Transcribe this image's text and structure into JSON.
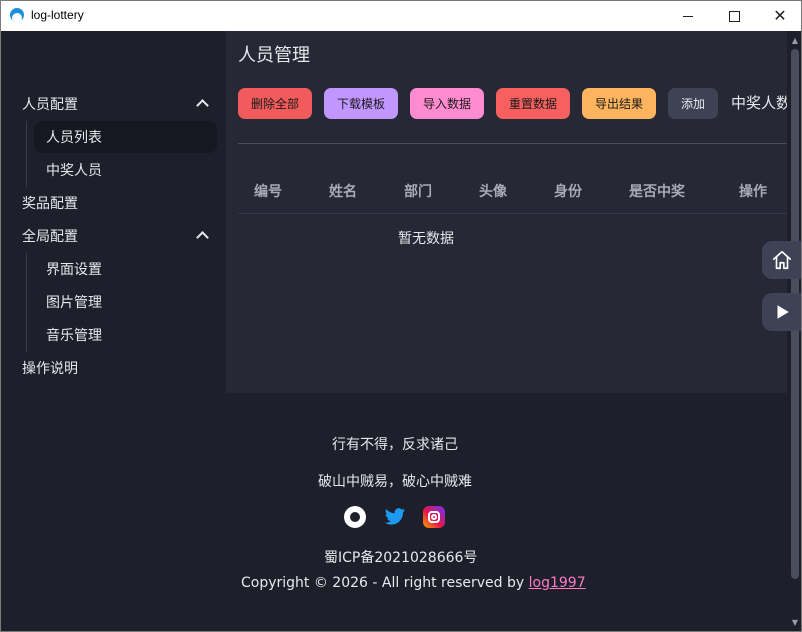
{
  "window": {
    "title": "log-lottery",
    "controls": {
      "minimize": "—",
      "maximize": "□",
      "close": "✕"
    }
  },
  "sidebar": {
    "items": [
      {
        "label": "人员配置",
        "expanded": true,
        "children": [
          {
            "label": "人员列表",
            "active": true
          },
          {
            "label": "中奖人员",
            "active": false
          }
        ]
      },
      {
        "label": "奖品配置"
      },
      {
        "label": "全局配置",
        "expanded": true,
        "children": [
          {
            "label": "界面设置"
          },
          {
            "label": "图片管理"
          },
          {
            "label": "音乐管理"
          }
        ]
      },
      {
        "label": "操作说明"
      }
    ]
  },
  "main": {
    "title": "人员管理",
    "buttons": {
      "delete_all": "删除全部",
      "download_template": "下载模板",
      "import": "导入数据",
      "reset": "重置数据",
      "export": "导出结果",
      "add": "添加"
    },
    "winner_label": "中奖人数",
    "table": {
      "headers": [
        "编号",
        "姓名",
        "部门",
        "头像",
        "身份",
        "是否中奖",
        "操作"
      ],
      "empty_text": "暂无数据"
    }
  },
  "footer": {
    "quote_1": "行有不得，反求诸己",
    "quote_2": "破山中贼易，破心中贼难",
    "icp": "蜀ICP备2021028666号",
    "copyright": "Copyright © 2026 - All right reserved by",
    "author_link": "log1997",
    "social_icons": [
      "github-icon",
      "twitter-icon",
      "instagram-icon"
    ]
  },
  "colors": {
    "accent_link": "#ff7ac8",
    "delete": "#f15b5b",
    "template": "#c197ff",
    "import": "#ff8cd0",
    "reset": "#f85f5f",
    "export": "#ffb45f"
  }
}
